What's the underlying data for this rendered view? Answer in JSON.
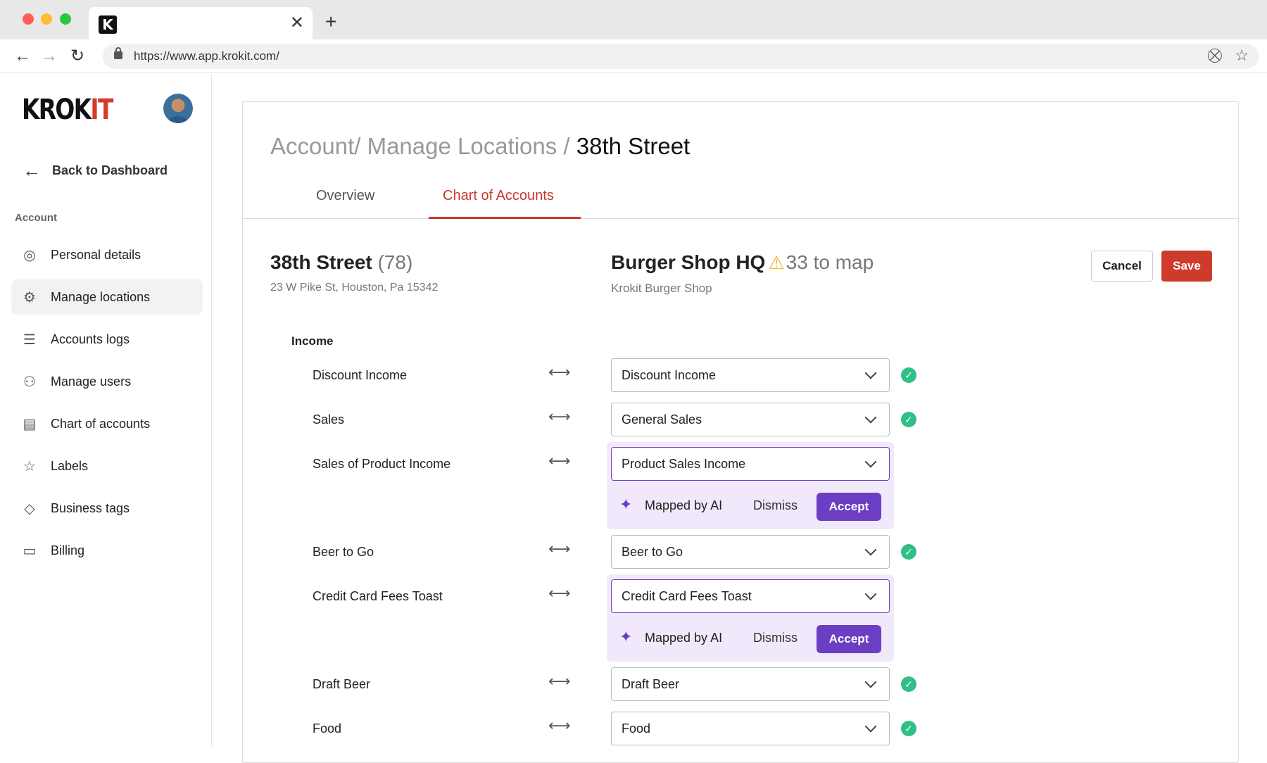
{
  "browser": {
    "tab_title": "",
    "favicon_letter": "K",
    "url": "https://www.app.krokit.com/"
  },
  "sidebar": {
    "logo_main": "KROK",
    "logo_accent": "IT",
    "back_label": "Back to Dashboard",
    "section_label": "Account",
    "items": [
      {
        "label": "Personal details",
        "icon": "user-circle-icon",
        "glyph": "◎"
      },
      {
        "label": "Manage locations",
        "icon": "location-gear-icon",
        "glyph": "⚙",
        "active": true
      },
      {
        "label": "Accounts logs",
        "icon": "list-icon",
        "glyph": "☰"
      },
      {
        "label": "Manage users",
        "icon": "users-icon",
        "glyph": "⚇"
      },
      {
        "label": "Chart of accounts",
        "icon": "clipboard-icon",
        "glyph": "▤"
      },
      {
        "label": "Labels",
        "icon": "star-icon",
        "glyph": "☆"
      },
      {
        "label": "Business tags",
        "icon": "tag-icon",
        "glyph": "◇"
      },
      {
        "label": "Billing",
        "icon": "credit-card-icon",
        "glyph": "▭"
      }
    ]
  },
  "main": {
    "breadcrumb_path": "Account/ Manage Locations / ",
    "breadcrumb_current": "38th Street",
    "tabs": [
      {
        "label": "Overview",
        "active": false
      },
      {
        "label": "Chart of Accounts",
        "active": true
      }
    ],
    "location": {
      "name": "38th Street",
      "count": "(78)",
      "address": "23 W Pike St, Houston, Pa 15342"
    },
    "target": {
      "name": "Burger Shop HQ",
      "to_map": "33 to map",
      "subtitle": "Krokit Burger Shop"
    },
    "cancel_label": "Cancel",
    "save_label": "Save",
    "group_label": "Income",
    "ai_labels": {
      "mapped": "Mapped by AI",
      "dismiss": "Dismiss",
      "accept": "Accept"
    },
    "rows": [
      {
        "source": "Discount Income",
        "target": "Discount Income",
        "ai": false
      },
      {
        "source": "Sales",
        "target": "General Sales",
        "ai": false
      },
      {
        "source": "Sales of Product Income",
        "target": "Product Sales Income",
        "ai": true
      },
      {
        "source": "Beer to Go",
        "target": "Beer to Go",
        "ai": false
      },
      {
        "source": "Credit Card Fees Toast",
        "target": "Credit Card Fees Toast",
        "ai": true
      },
      {
        "source": "Draft Beer",
        "target": "Draft Beer",
        "ai": false
      },
      {
        "source": "Food",
        "target": "Food",
        "ai": false
      }
    ]
  },
  "colors": {
    "brand_red": "#cf3b2b",
    "ai_purple": "#6b3ec3",
    "ai_bg": "#f1e9fb",
    "check_green": "#2fbf87"
  }
}
